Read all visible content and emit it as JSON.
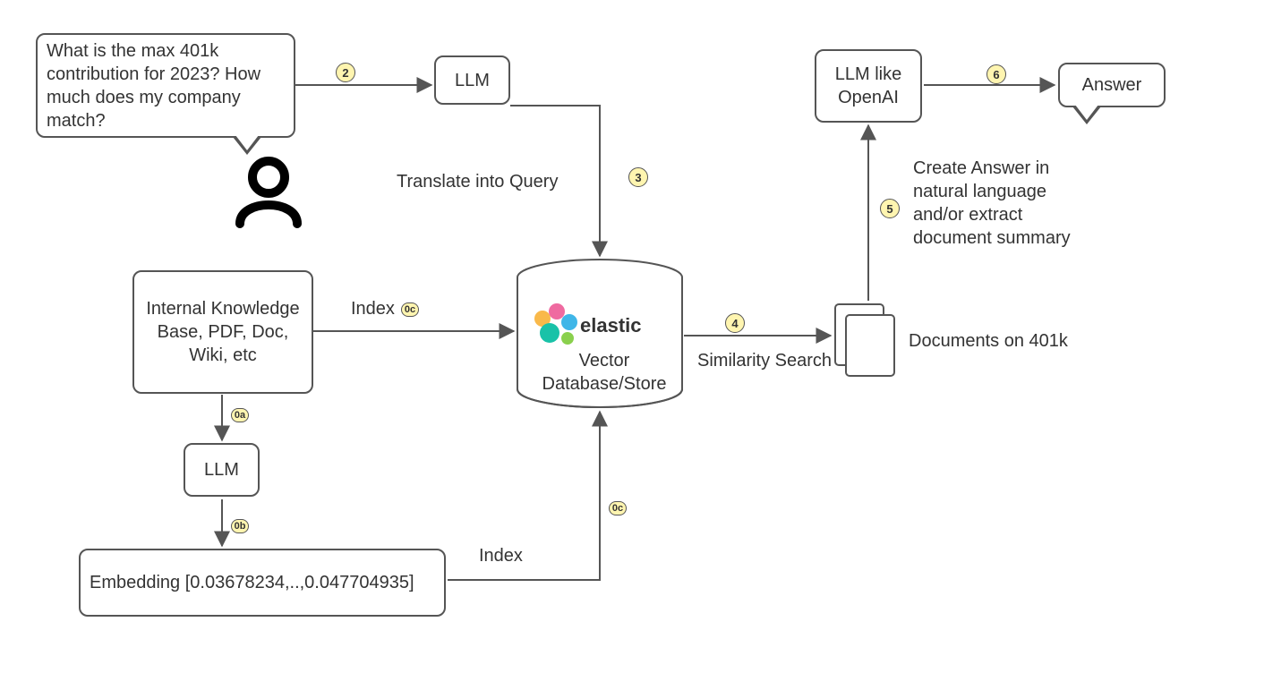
{
  "question_bubble": "What is the max 401k contribution for 2023? How much does my company match?",
  "llm1_label": "LLM",
  "translate_label": "Translate into Query",
  "knowledge_base": "Internal Knowledge Base, PDF, Doc, Wiki, etc",
  "llm2_label": "LLM",
  "embedding": "Embedding [0.03678234,..,0.047704935]",
  "index_label_top": "Index",
  "index_label_bottom": "Index",
  "vector_db_name": "elastic",
  "vector_db_sub": "Vector Database/Store",
  "similarity_label": "Similarity Search",
  "documents_label": "Documents on 401k",
  "create_answer_label": "Create Answer in natural language and/or extract document summary",
  "llm_openai": "LLM like OpenAI",
  "answer_bubble": "Answer",
  "badges": {
    "b2": "2",
    "b3": "3",
    "b4": "4",
    "b5": "5",
    "b6": "6",
    "b0a": "0a",
    "b0b": "0b",
    "b0c_top": "0c",
    "b0c_bottom": "0c"
  }
}
